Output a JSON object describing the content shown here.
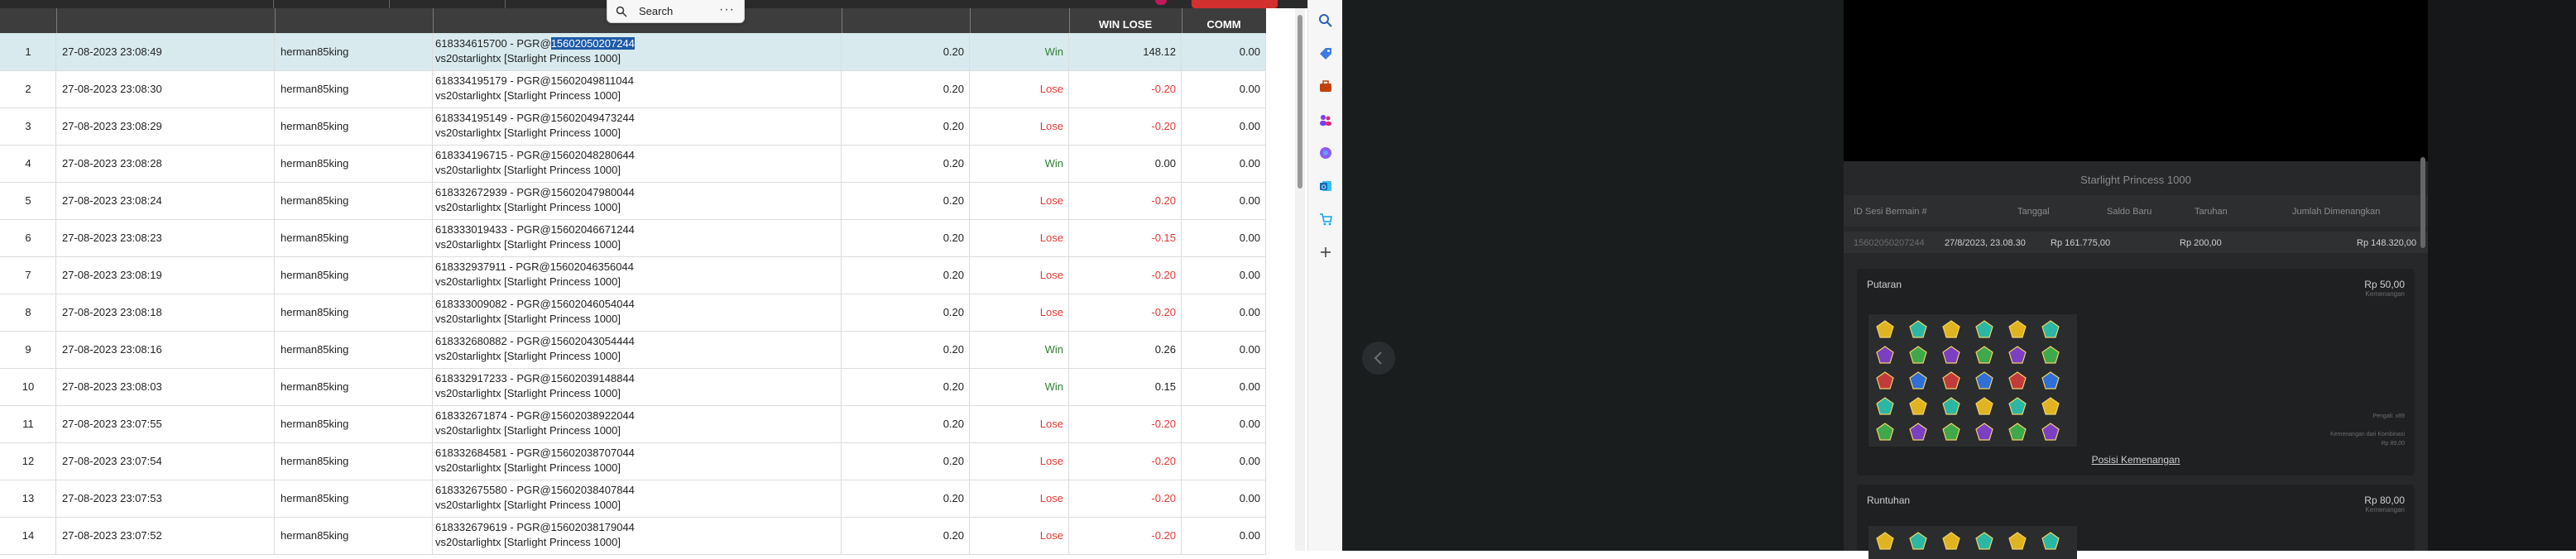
{
  "search": {
    "label": "Search",
    "more": "···"
  },
  "table": {
    "headers": {
      "bet": "",
      "status": "",
      "win_lose": "WIN LOSE",
      "comm": "COMM"
    },
    "rows": [
      {
        "no": "1",
        "time": "27-08-2023 23:08:49",
        "user": "herman85king",
        "desc_id": "618334615700 - PGR@",
        "desc_hl": "15602050207244",
        "desc2": "vs20starlightx [Starlight Princess 1000]",
        "bet": "0.20",
        "status": "Win",
        "wl": "148.12",
        "comm": "0.00"
      },
      {
        "no": "2",
        "time": "27-08-2023 23:08:30",
        "user": "herman85king",
        "desc_id": "618334195179 - PGR@15602049811044",
        "desc_hl": "",
        "desc2": "vs20starlightx [Starlight Princess 1000]",
        "bet": "0.20",
        "status": "Lose",
        "wl": "-0.20",
        "comm": "0.00"
      },
      {
        "no": "3",
        "time": "27-08-2023 23:08:29",
        "user": "herman85king",
        "desc_id": "618334195149 - PGR@15602049473244",
        "desc_hl": "",
        "desc2": "vs20starlightx [Starlight Princess 1000]",
        "bet": "0.20",
        "status": "Lose",
        "wl": "-0.20",
        "comm": "0.00"
      },
      {
        "no": "4",
        "time": "27-08-2023 23:08:28",
        "user": "herman85king",
        "desc_id": "618334196715 - PGR@15602048280644",
        "desc_hl": "",
        "desc2": "vs20starlightx [Starlight Princess 1000]",
        "bet": "0.20",
        "status": "Win",
        "wl": "0.00",
        "comm": "0.00"
      },
      {
        "no": "5",
        "time": "27-08-2023 23:08:24",
        "user": "herman85king",
        "desc_id": "618332672939 - PGR@15602047980044",
        "desc_hl": "",
        "desc2": "vs20starlightx [Starlight Princess 1000]",
        "bet": "0.20",
        "status": "Lose",
        "wl": "-0.20",
        "comm": "0.00"
      },
      {
        "no": "6",
        "time": "27-08-2023 23:08:23",
        "user": "herman85king",
        "desc_id": "618333019433 - PGR@15602046671244",
        "desc_hl": "",
        "desc2": "vs20starlightx [Starlight Princess 1000]",
        "bet": "0.20",
        "status": "Lose",
        "wl": "-0.15",
        "comm": "0.00"
      },
      {
        "no": "7",
        "time": "27-08-2023 23:08:19",
        "user": "herman85king",
        "desc_id": "618332937911 - PGR@15602046356044",
        "desc_hl": "",
        "desc2": "vs20starlightx [Starlight Princess 1000]",
        "bet": "0.20",
        "status": "Lose",
        "wl": "-0.20",
        "comm": "0.00"
      },
      {
        "no": "8",
        "time": "27-08-2023 23:08:18",
        "user": "herman85king",
        "desc_id": "618333009082 - PGR@15602046054044",
        "desc_hl": "",
        "desc2": "vs20starlightx [Starlight Princess 1000]",
        "bet": "0.20",
        "status": "Lose",
        "wl": "-0.20",
        "comm": "0.00"
      },
      {
        "no": "9",
        "time": "27-08-2023 23:08:16",
        "user": "herman85king",
        "desc_id": "618332680882 - PGR@15602043054444",
        "desc_hl": "",
        "desc2": "vs20starlightx [Starlight Princess 1000]",
        "bet": "0.20",
        "status": "Win",
        "wl": "0.26",
        "comm": "0.00"
      },
      {
        "no": "10",
        "time": "27-08-2023 23:08:03",
        "user": "herman85king",
        "desc_id": "618332917233 - PGR@15602039148844",
        "desc_hl": "",
        "desc2": "vs20starlightx [Starlight Princess 1000]",
        "bet": "0.20",
        "status": "Win",
        "wl": "0.15",
        "comm": "0.00"
      },
      {
        "no": "11",
        "time": "27-08-2023 23:07:55",
        "user": "herman85king",
        "desc_id": "618332671874 - PGR@15602038922044",
        "desc_hl": "",
        "desc2": "vs20starlightx [Starlight Princess 1000]",
        "bet": "0.20",
        "status": "Lose",
        "wl": "-0.20",
        "comm": "0.00"
      },
      {
        "no": "12",
        "time": "27-08-2023 23:07:54",
        "user": "herman85king",
        "desc_id": "618332684581 - PGR@15602038707044",
        "desc_hl": "",
        "desc2": "vs20starlightx [Starlight Princess 1000]",
        "bet": "0.20",
        "status": "Lose",
        "wl": "-0.20",
        "comm": "0.00"
      },
      {
        "no": "13",
        "time": "27-08-2023 23:07:53",
        "user": "herman85king",
        "desc_id": "618332675580 - PGR@15602038407844",
        "desc_hl": "",
        "desc2": "vs20starlightx [Starlight Princess 1000]",
        "bet": "0.20",
        "status": "Lose",
        "wl": "-0.20",
        "comm": "0.00"
      },
      {
        "no": "14",
        "time": "27-08-2023 23:07:52",
        "user": "herman85king",
        "desc_id": "618332679619 - PGR@15602038179044",
        "desc_hl": "",
        "desc2": "vs20starlightx [Starlight Princess 1000]",
        "bet": "0.20",
        "status": "Lose",
        "wl": "-0.20",
        "comm": "0.00"
      }
    ]
  },
  "colors": {
    "win": "#2e7d32",
    "lose": "#e53935",
    "selected_row": "#d8eaee",
    "header": "#3d3d3d",
    "highlight": "#1e5aa8"
  },
  "side_icons": [
    "search-icon",
    "tag-icon",
    "briefcase-icon",
    "people-icon",
    "copilot-icon",
    "outlook-icon",
    "cart-icon",
    "plus-icon"
  ],
  "game": {
    "title": "Starlight Princess 1000",
    "headers": [
      "ID Sesi Bermain #",
      "Tanggal",
      "Saldo Baru",
      "Taruhan",
      "Jumlah Dimenangkan"
    ],
    "values": [
      "15602050207244",
      "27/8/2023, 23.08.30",
      "Rp 161.775,00",
      "Rp 200,00",
      "Rp 148.320,00"
    ],
    "putaran": {
      "label": "Putaran",
      "amount": "Rp 50,00",
      "sub": "Kemenangan",
      "link": "Posisi Kemenangan",
      "meta1": "Pengali: x89",
      "meta2": "Kemenangan dari Kombinasi",
      "meta3": "Rp 89,00"
    },
    "runtuhan": {
      "label": "Runtuhan",
      "amount": "Rp 80,00",
      "sub": "Kemenangan"
    }
  }
}
